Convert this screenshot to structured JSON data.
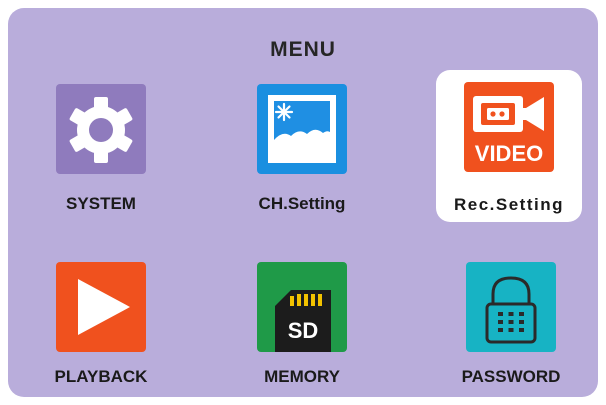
{
  "menu": {
    "title": "MENU",
    "items": [
      {
        "label": "SYSTEM",
        "icon": "gear-icon",
        "color": "#8f7bbd",
        "selected": false
      },
      {
        "label": "CH.Setting",
        "icon": "picture-icon",
        "color": "#1a8fe0",
        "selected": false
      },
      {
        "label": "Rec.Setting",
        "icon": "video-camera-icon",
        "color": "#f0511e",
        "selected": true,
        "icon_text": "VIDEO"
      },
      {
        "label": "PLAYBACK",
        "icon": "play-icon",
        "color": "#f0511e",
        "selected": false
      },
      {
        "label": "MEMORY",
        "icon": "sd-card-icon",
        "color": "#1f9a48",
        "selected": false,
        "icon_text": "SD"
      },
      {
        "label": "PASSWORD",
        "icon": "padlock-icon",
        "color": "#17b3c4",
        "selected": false
      }
    ]
  },
  "colors": {
    "panel_background": "#b9addb",
    "selection_background": "#ffffff"
  }
}
